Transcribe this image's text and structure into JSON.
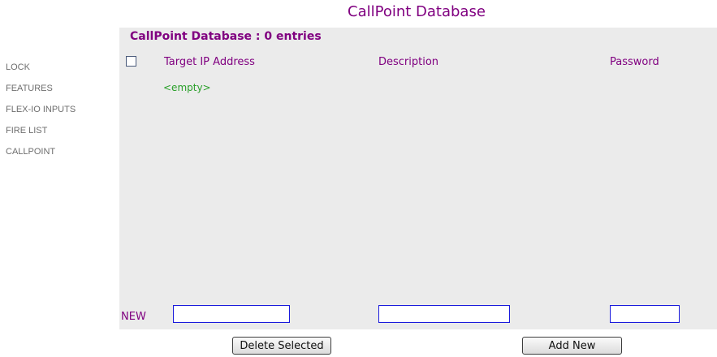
{
  "header": {
    "title": "CallPoint Database"
  },
  "sidebar": {
    "items": [
      {
        "label": "LOCK"
      },
      {
        "label": "FEATURES"
      },
      {
        "label": "FLEX-IO INPUTS"
      },
      {
        "label": "FIRE LIST"
      },
      {
        "label": "CALLPOINT"
      }
    ]
  },
  "panel": {
    "title": "CallPoint Database : 0 entries",
    "columns": {
      "ip": "Target IP Address",
      "description": "Description",
      "password": "Password"
    },
    "empty_text": "<empty>",
    "new_label": "NEW",
    "new_row": {
      "ip_value": "",
      "description_value": "",
      "password_value": ""
    }
  },
  "actions": {
    "delete_label": "Delete Selected",
    "add_label": "Add New"
  },
  "colors": {
    "accent": "#800080",
    "panel_bg": "#ebebeb",
    "empty_text": "#2aa02a",
    "input_border": "#1a1adc",
    "sidebar_text": "#6e6e6e"
  }
}
